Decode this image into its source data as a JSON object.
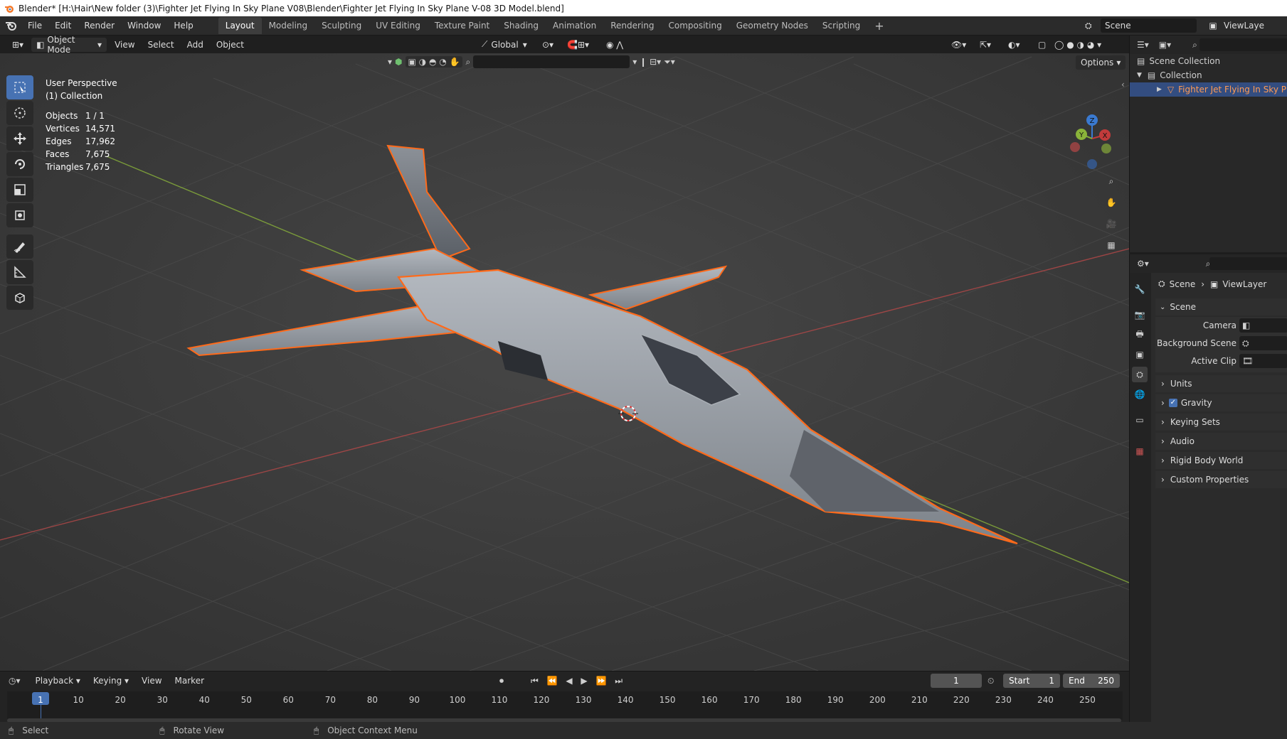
{
  "window": {
    "title": "Blender* [H:\\Hair\\New folder (3)\\Fighter Jet Flying In Sky Plane V08\\Blender\\Fighter Jet Flying In Sky Plane V-08 3D Model.blend]"
  },
  "menu": [
    "File",
    "Edit",
    "Render",
    "Window",
    "Help"
  ],
  "workspace_tabs": [
    "Layout",
    "Modeling",
    "Sculpting",
    "UV Editing",
    "Texture Paint",
    "Shading",
    "Animation",
    "Rendering",
    "Compositing",
    "Geometry Nodes",
    "Scripting"
  ],
  "active_workspace": "Layout",
  "scene_selector": "Scene",
  "viewlayer_selector": "ViewLaye",
  "viewport_header": {
    "mode": "Object Mode",
    "menus": [
      "View",
      "Select",
      "Add",
      "Object"
    ],
    "transform_orientation": "Global",
    "options": "Options"
  },
  "viewport_overlay": {
    "perspective": "User Perspective",
    "collection": "(1) Collection",
    "stats": [
      {
        "label": "Objects",
        "value": "1 / 1"
      },
      {
        "label": "Vertices",
        "value": "14,571"
      },
      {
        "label": "Edges",
        "value": "17,962"
      },
      {
        "label": "Faces",
        "value": "7,675"
      },
      {
        "label": "Triangles",
        "value": "7,675"
      }
    ]
  },
  "gizmo_axes": {
    "z": "Z",
    "y": "Y",
    "x": "X"
  },
  "outliner": {
    "items": [
      {
        "label": "Scene Collection"
      },
      {
        "label": "Collection"
      },
      {
        "label": "Fighter Jet Flying In Sky Plan"
      }
    ]
  },
  "properties": {
    "breadcrumb": [
      "Scene",
      "ViewLayer"
    ],
    "panel_title": "Scene",
    "fields": [
      {
        "label": "Camera"
      },
      {
        "label": "Background Scene"
      },
      {
        "label": "Active Clip"
      }
    ],
    "subpanels": [
      "Units",
      "Gravity",
      "Keying Sets",
      "Audio",
      "Rigid Body World",
      "Custom Properties"
    ],
    "gravity_checked": true
  },
  "timeline": {
    "menus": [
      "Playback",
      "Keying",
      "View",
      "Marker"
    ],
    "current_frame": "1",
    "start_label": "Start",
    "start": "1",
    "end_label": "End",
    "end": "250",
    "ticks": [
      "1",
      "10",
      "20",
      "30",
      "40",
      "50",
      "60",
      "70",
      "80",
      "90",
      "100",
      "110",
      "120",
      "130",
      "140",
      "150",
      "160",
      "170",
      "180",
      "190",
      "200",
      "210",
      "220",
      "230",
      "240",
      "250"
    ]
  },
  "statusbar": [
    "Select",
    "Rotate View",
    "Object Context Menu"
  ],
  "colors": {
    "accent": "#4772b3",
    "selection_outline": "#ff6a1a",
    "x_axis": "#c23b3b",
    "y_axis": "#8ab33a",
    "z_axis": "#3a7ad1"
  }
}
